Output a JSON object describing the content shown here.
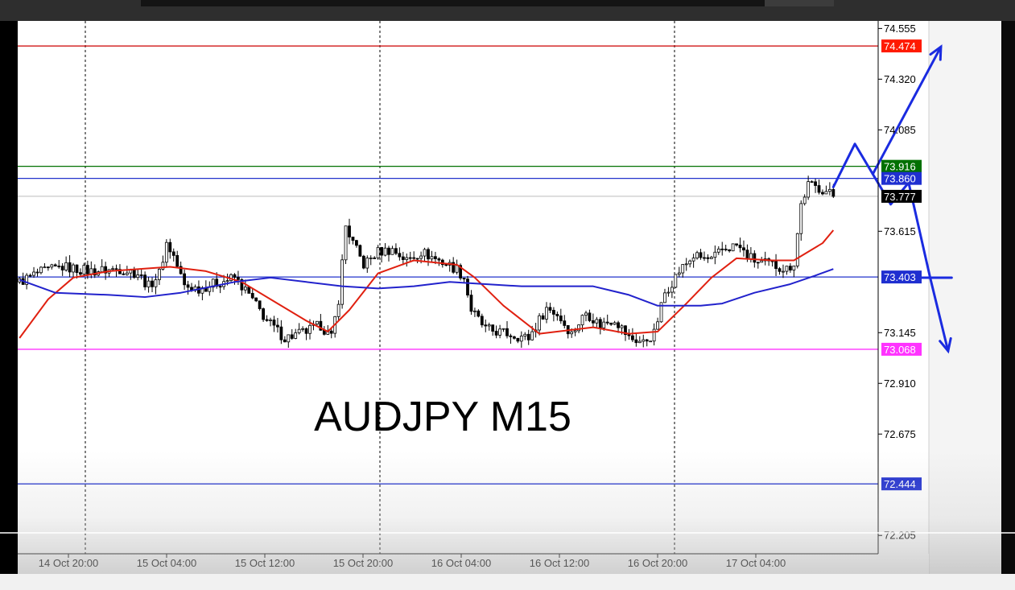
{
  "chart_data": {
    "type": "candlestick",
    "title": "AUDJPY M15",
    "symbol": "AUDJPY",
    "timeframe": "M15",
    "y_range": [
      72.12,
      74.59
    ],
    "y_ticks": [
      "74.555",
      "74.320",
      "74.085",
      "73.615",
      "73.145",
      "72.910",
      "72.675",
      "72.205"
    ],
    "x_ticks": [
      "14 Oct 20:00",
      "15 Oct 04:00",
      "15 Oct 12:00",
      "15 Oct 20:00",
      "16 Oct 04:00",
      "16 Oct 12:00",
      "16 Oct 20:00",
      "17 Oct 04:00"
    ],
    "bar_count": 240,
    "vertical_gridlines_at_ticks": [
      "14 Oct 20:00",
      "15 Oct 20:00",
      "16 Oct 20:00"
    ],
    "horizontal_levels": [
      {
        "value": 74.474,
        "label": "74.474",
        "color": "#cc0000",
        "label_bg": "#ff1a00"
      },
      {
        "value": 73.916,
        "label": "73.916",
        "color": "#007000",
        "label_bg": "#007000"
      },
      {
        "value": 73.86,
        "label": "73.860",
        "color": "#2233cc",
        "label_bg": "#1f2fd0"
      },
      {
        "value": 73.777,
        "label": "73.777",
        "color": "#bbbbbb",
        "label_bg": "#000000"
      },
      {
        "value": 73.403,
        "label": "73.403",
        "color": "#2233cc",
        "label_bg": "#1f2fd0"
      },
      {
        "value": 73.068,
        "label": "73.068",
        "color": "#ff33ff",
        "label_bg": "#ff33ff"
      },
      {
        "value": 72.444,
        "label": "72.444",
        "color": "#2233cc",
        "label_bg": "#1f2fd0"
      }
    ],
    "price_path": [
      [
        0,
        73.38
      ],
      [
        5,
        73.42
      ],
      [
        12,
        73.45
      ],
      [
        20,
        73.43
      ],
      [
        28,
        73.44
      ],
      [
        33,
        73.42
      ],
      [
        36,
        73.36
      ],
      [
        39,
        73.42
      ],
      [
        41,
        73.56
      ],
      [
        43,
        73.5
      ],
      [
        46,
        73.36
      ],
      [
        50,
        73.35
      ],
      [
        56,
        73.38
      ],
      [
        60,
        73.4
      ],
      [
        64,
        73.32
      ],
      [
        69,
        73.2
      ],
      [
        74,
        73.12
      ],
      [
        80,
        73.15
      ],
      [
        84,
        73.18
      ],
      [
        87,
        73.12
      ],
      [
        89,
        73.3
      ],
      [
        91,
        73.64
      ],
      [
        93,
        73.56
      ],
      [
        96,
        73.46
      ],
      [
        100,
        73.52
      ],
      [
        104,
        73.53
      ],
      [
        108,
        73.48
      ],
      [
        112,
        73.52
      ],
      [
        117,
        73.48
      ],
      [
        122,
        73.44
      ],
      [
        124,
        73.4
      ],
      [
        126,
        73.25
      ],
      [
        130,
        73.16
      ],
      [
        136,
        73.14
      ],
      [
        142,
        73.12
      ],
      [
        147,
        73.26
      ],
      [
        150,
        73.23
      ],
      [
        154,
        73.14
      ],
      [
        158,
        73.24
      ],
      [
        162,
        73.18
      ],
      [
        166,
        73.21
      ],
      [
        170,
        73.12
      ],
      [
        174,
        73.1
      ],
      [
        177,
        73.14
      ],
      [
        180,
        73.33
      ],
      [
        184,
        73.43
      ],
      [
        188,
        73.5
      ],
      [
        193,
        73.48
      ],
      [
        196,
        73.53
      ],
      [
        200,
        73.55
      ],
      [
        203,
        73.5
      ],
      [
        206,
        73.47
      ],
      [
        210,
        73.46
      ],
      [
        214,
        73.44
      ],
      [
        216,
        73.47
      ],
      [
        218,
        73.74
      ],
      [
        220,
        73.83
      ],
      [
        224,
        73.81
      ],
      [
        227,
        73.78
      ]
    ],
    "moving_averages": [
      {
        "color": "#e02010",
        "path": [
          [
            0,
            73.12
          ],
          [
            8,
            73.3
          ],
          [
            15,
            73.4
          ],
          [
            25,
            73.43
          ],
          [
            42,
            73.45
          ],
          [
            52,
            73.43
          ],
          [
            62,
            73.38
          ],
          [
            72,
            73.28
          ],
          [
            80,
            73.2
          ],
          [
            86,
            73.15
          ],
          [
            92,
            73.25
          ],
          [
            100,
            73.42
          ],
          [
            110,
            73.48
          ],
          [
            122,
            73.46
          ],
          [
            127,
            73.4
          ],
          [
            135,
            73.27
          ],
          [
            145,
            73.14
          ],
          [
            160,
            73.17
          ],
          [
            170,
            73.14
          ],
          [
            178,
            73.15
          ],
          [
            186,
            73.28
          ],
          [
            193,
            73.4
          ],
          [
            200,
            73.49
          ],
          [
            210,
            73.48
          ],
          [
            216,
            73.48
          ],
          [
            224,
            73.56
          ],
          [
            227,
            73.62
          ]
        ]
      },
      {
        "color": "#2222cc",
        "path": [
          [
            0,
            73.39
          ],
          [
            10,
            73.33
          ],
          [
            25,
            73.32
          ],
          [
            35,
            73.31
          ],
          [
            45,
            73.33
          ],
          [
            60,
            73.38
          ],
          [
            70,
            73.4
          ],
          [
            80,
            73.38
          ],
          [
            90,
            73.36
          ],
          [
            100,
            73.35
          ],
          [
            110,
            73.36
          ],
          [
            120,
            73.38
          ],
          [
            130,
            73.37
          ],
          [
            140,
            73.36
          ],
          [
            150,
            73.36
          ],
          [
            160,
            73.36
          ],
          [
            170,
            73.32
          ],
          [
            178,
            73.27
          ],
          [
            190,
            73.27
          ],
          [
            196,
            73.28
          ],
          [
            205,
            73.33
          ],
          [
            215,
            73.37
          ],
          [
            222,
            73.41
          ],
          [
            227,
            73.44
          ]
        ]
      }
    ],
    "scenario_arrows": [
      {
        "color": "#1a2be0",
        "path": [
          [
            227,
            73.82
          ],
          [
            233,
            74.02
          ],
          [
            238,
            73.88
          ],
          [
            257,
            74.47
          ]
        ]
      },
      {
        "color": "#1a2be0",
        "path": [
          [
            238,
            73.88
          ],
          [
            243,
            73.74
          ],
          [
            248,
            73.84
          ],
          [
            254,
            73.4
          ],
          [
            259,
            73.06
          ]
        ]
      },
      {
        "color": "#1a2be0",
        "path": [
          [
            244,
            73.4
          ],
          [
            260,
            73.4
          ]
        ]
      }
    ]
  }
}
